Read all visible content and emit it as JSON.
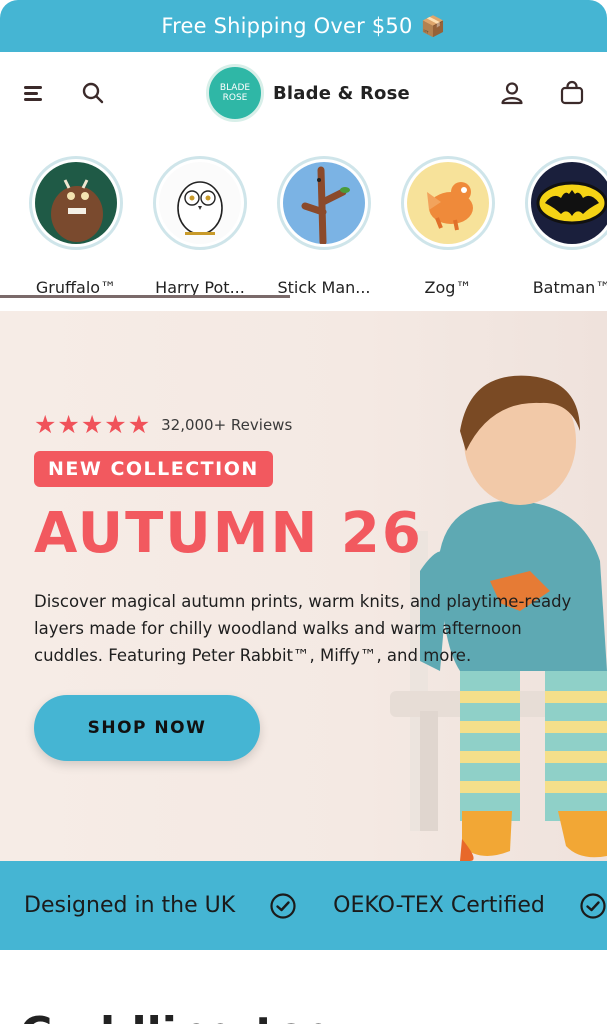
{
  "announcement": {
    "text": "Free Shipping Over $50",
    "icon": "box-emoji"
  },
  "header": {
    "brand": "Blade & Rose",
    "logo_text": "BLADE ROSE"
  },
  "characters": [
    {
      "label": "Gruffalo™"
    },
    {
      "label": "Harry Pot..."
    },
    {
      "label": "Stick Man..."
    },
    {
      "label": "Zog™"
    },
    {
      "label": "Batman™"
    }
  ],
  "hero": {
    "reviews": "32,000+ Reviews",
    "rating": 5,
    "badge": "NEW COLLECTION",
    "headline": "AUTUMN 26",
    "description": "Discover magical autumn prints, warm knits, and playtime-ready layers made for chilly woodland walks and warm afternoon cuddles. Featuring Peter Rabbit™, Miffy™, and more.",
    "cta": "SHOP NOW"
  },
  "usp": [
    {
      "text": "Designed in the UK"
    },
    {
      "text": "OEKO-TEX Certified"
    }
  ],
  "next_section_heading": "Cuddling tog...",
  "colors": {
    "accent": "#45b5d3",
    "coral": "#f2595f",
    "teal_logo": "#2fb7a6"
  }
}
